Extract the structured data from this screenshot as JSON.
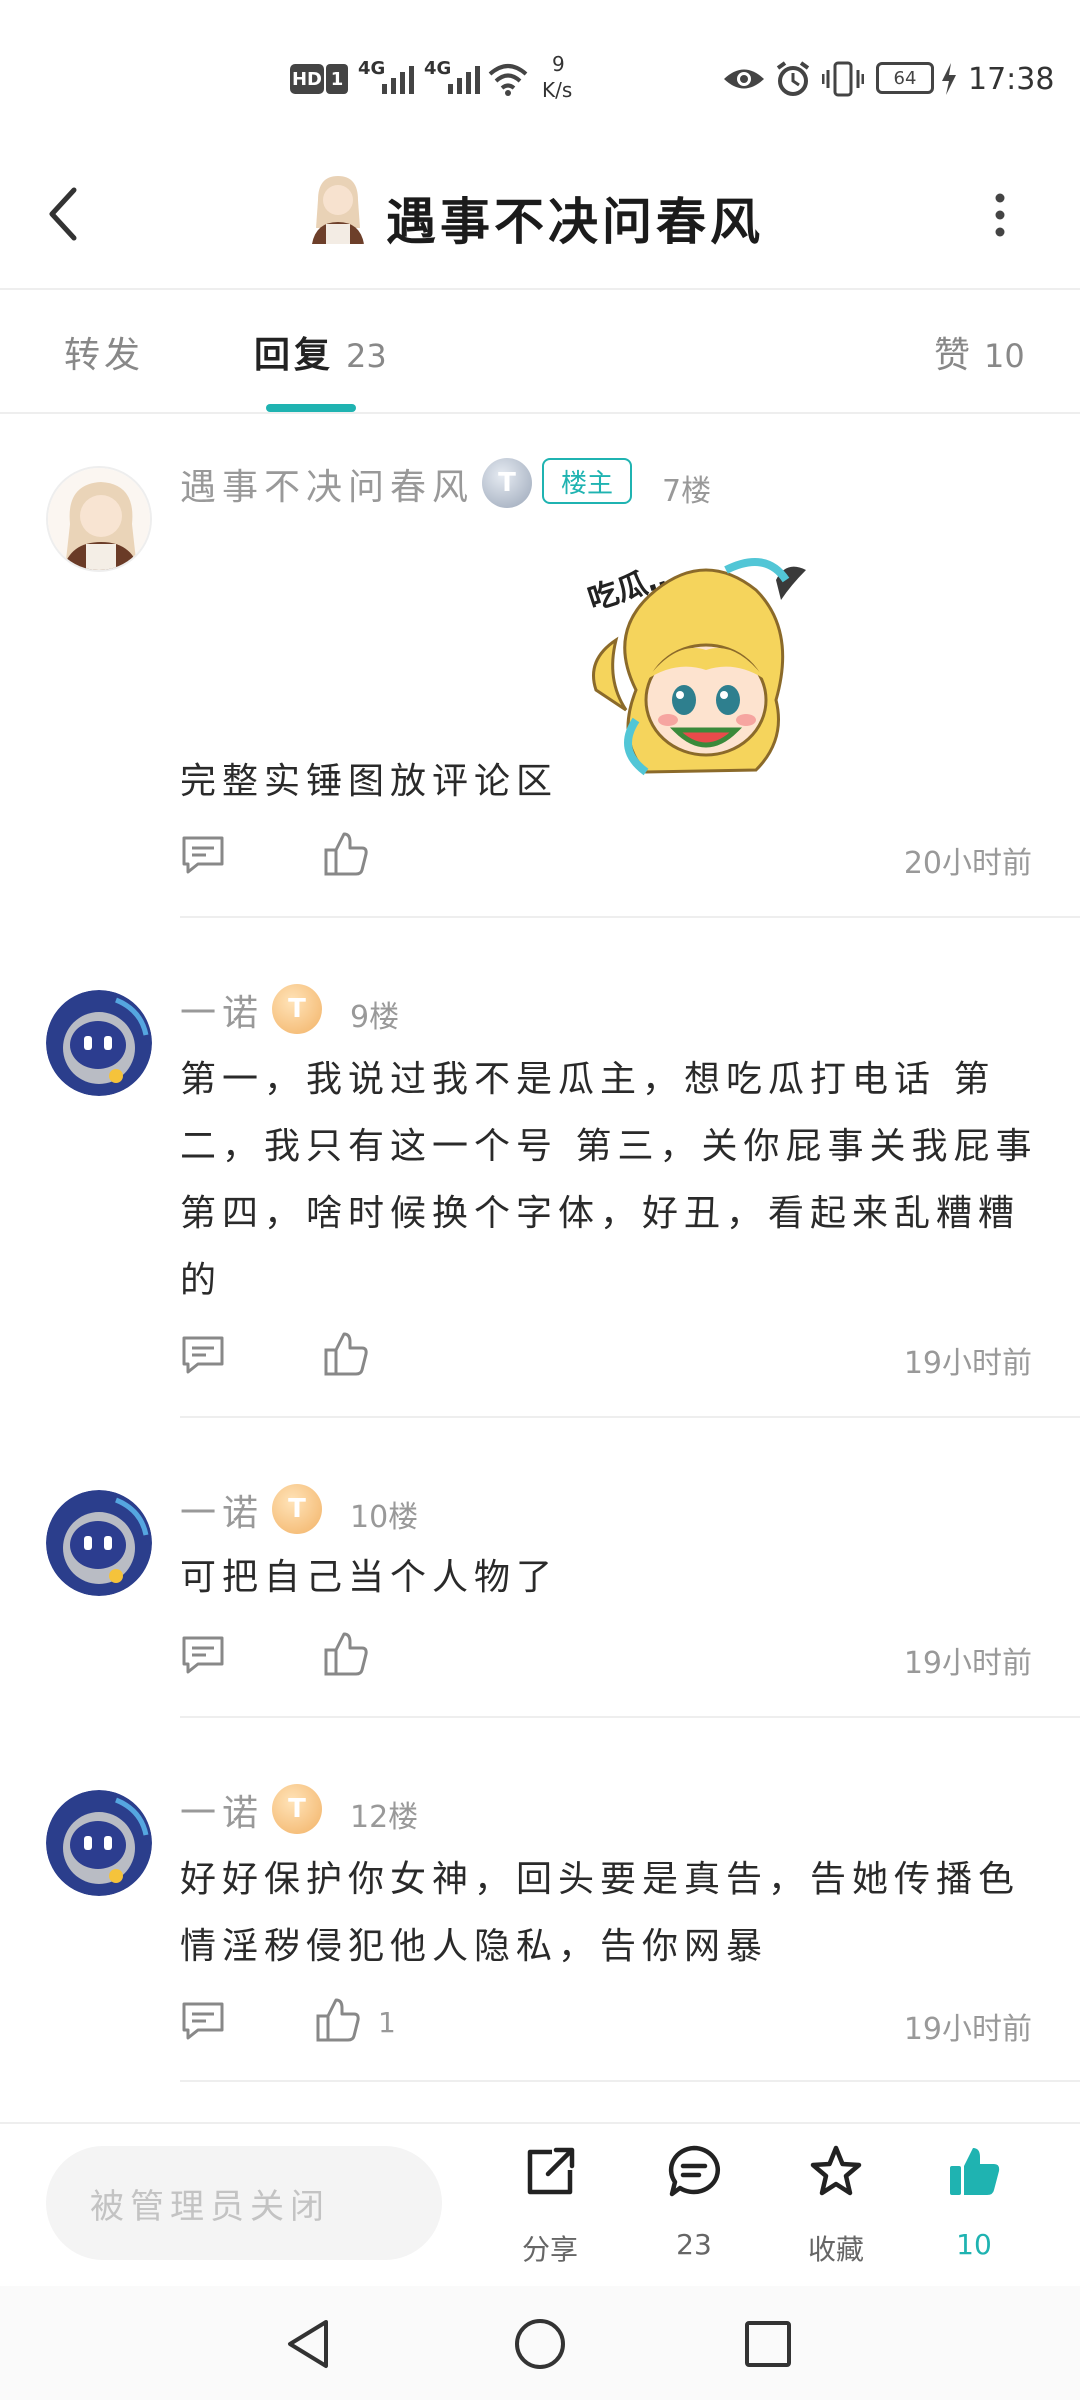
{
  "status_bar": {
    "hd": "HD",
    "sim": "1",
    "net1": "4G",
    "net2": "4G",
    "speed_value": "9",
    "speed_unit": "K/s",
    "battery": "64",
    "time": "17:38"
  },
  "header": {
    "title": "遇事不决问春风"
  },
  "tabs": [
    {
      "label": "转发"
    },
    {
      "label": "回复",
      "count": "23"
    },
    {
      "label": "赞",
      "count": "10"
    }
  ],
  "posts": [
    {
      "username": "遇事不决问春风",
      "level": "T",
      "owner_badge": "楼主",
      "floor": "7楼",
      "sticker_text": "吃瓜…",
      "content": "完整实锤图放评论区",
      "time": "20小时前",
      "likes": ""
    },
    {
      "username": "一诺",
      "level": "T",
      "floor": "9楼",
      "content": "第一，我说过我不是瓜主，想吃瓜打电话 第二，我只有这一个号 第三，关你屁事关我屁事 第四，啥时候换个字体，好丑，看起来乱糟糟的",
      "time": "19小时前",
      "likes": ""
    },
    {
      "username": "一诺",
      "level": "T",
      "floor": "10楼",
      "content": "可把自己当个人物了",
      "time": "19小时前",
      "likes": ""
    },
    {
      "username": "一诺",
      "level": "T",
      "floor": "12楼",
      "content": "好好保护你女神，回头要是真告，告她传播色情淫秽侵犯他人隐私，告你网暴",
      "time": "19小时前",
      "likes": "1"
    }
  ],
  "bottom_bar": {
    "input_placeholder": "被管理员关闭",
    "share_label": "分享",
    "comment_count": "23",
    "favorite_label": "收藏",
    "like_count": "10"
  },
  "colors": {
    "accent": "#1fb3b1",
    "muted_text": "#999999"
  }
}
